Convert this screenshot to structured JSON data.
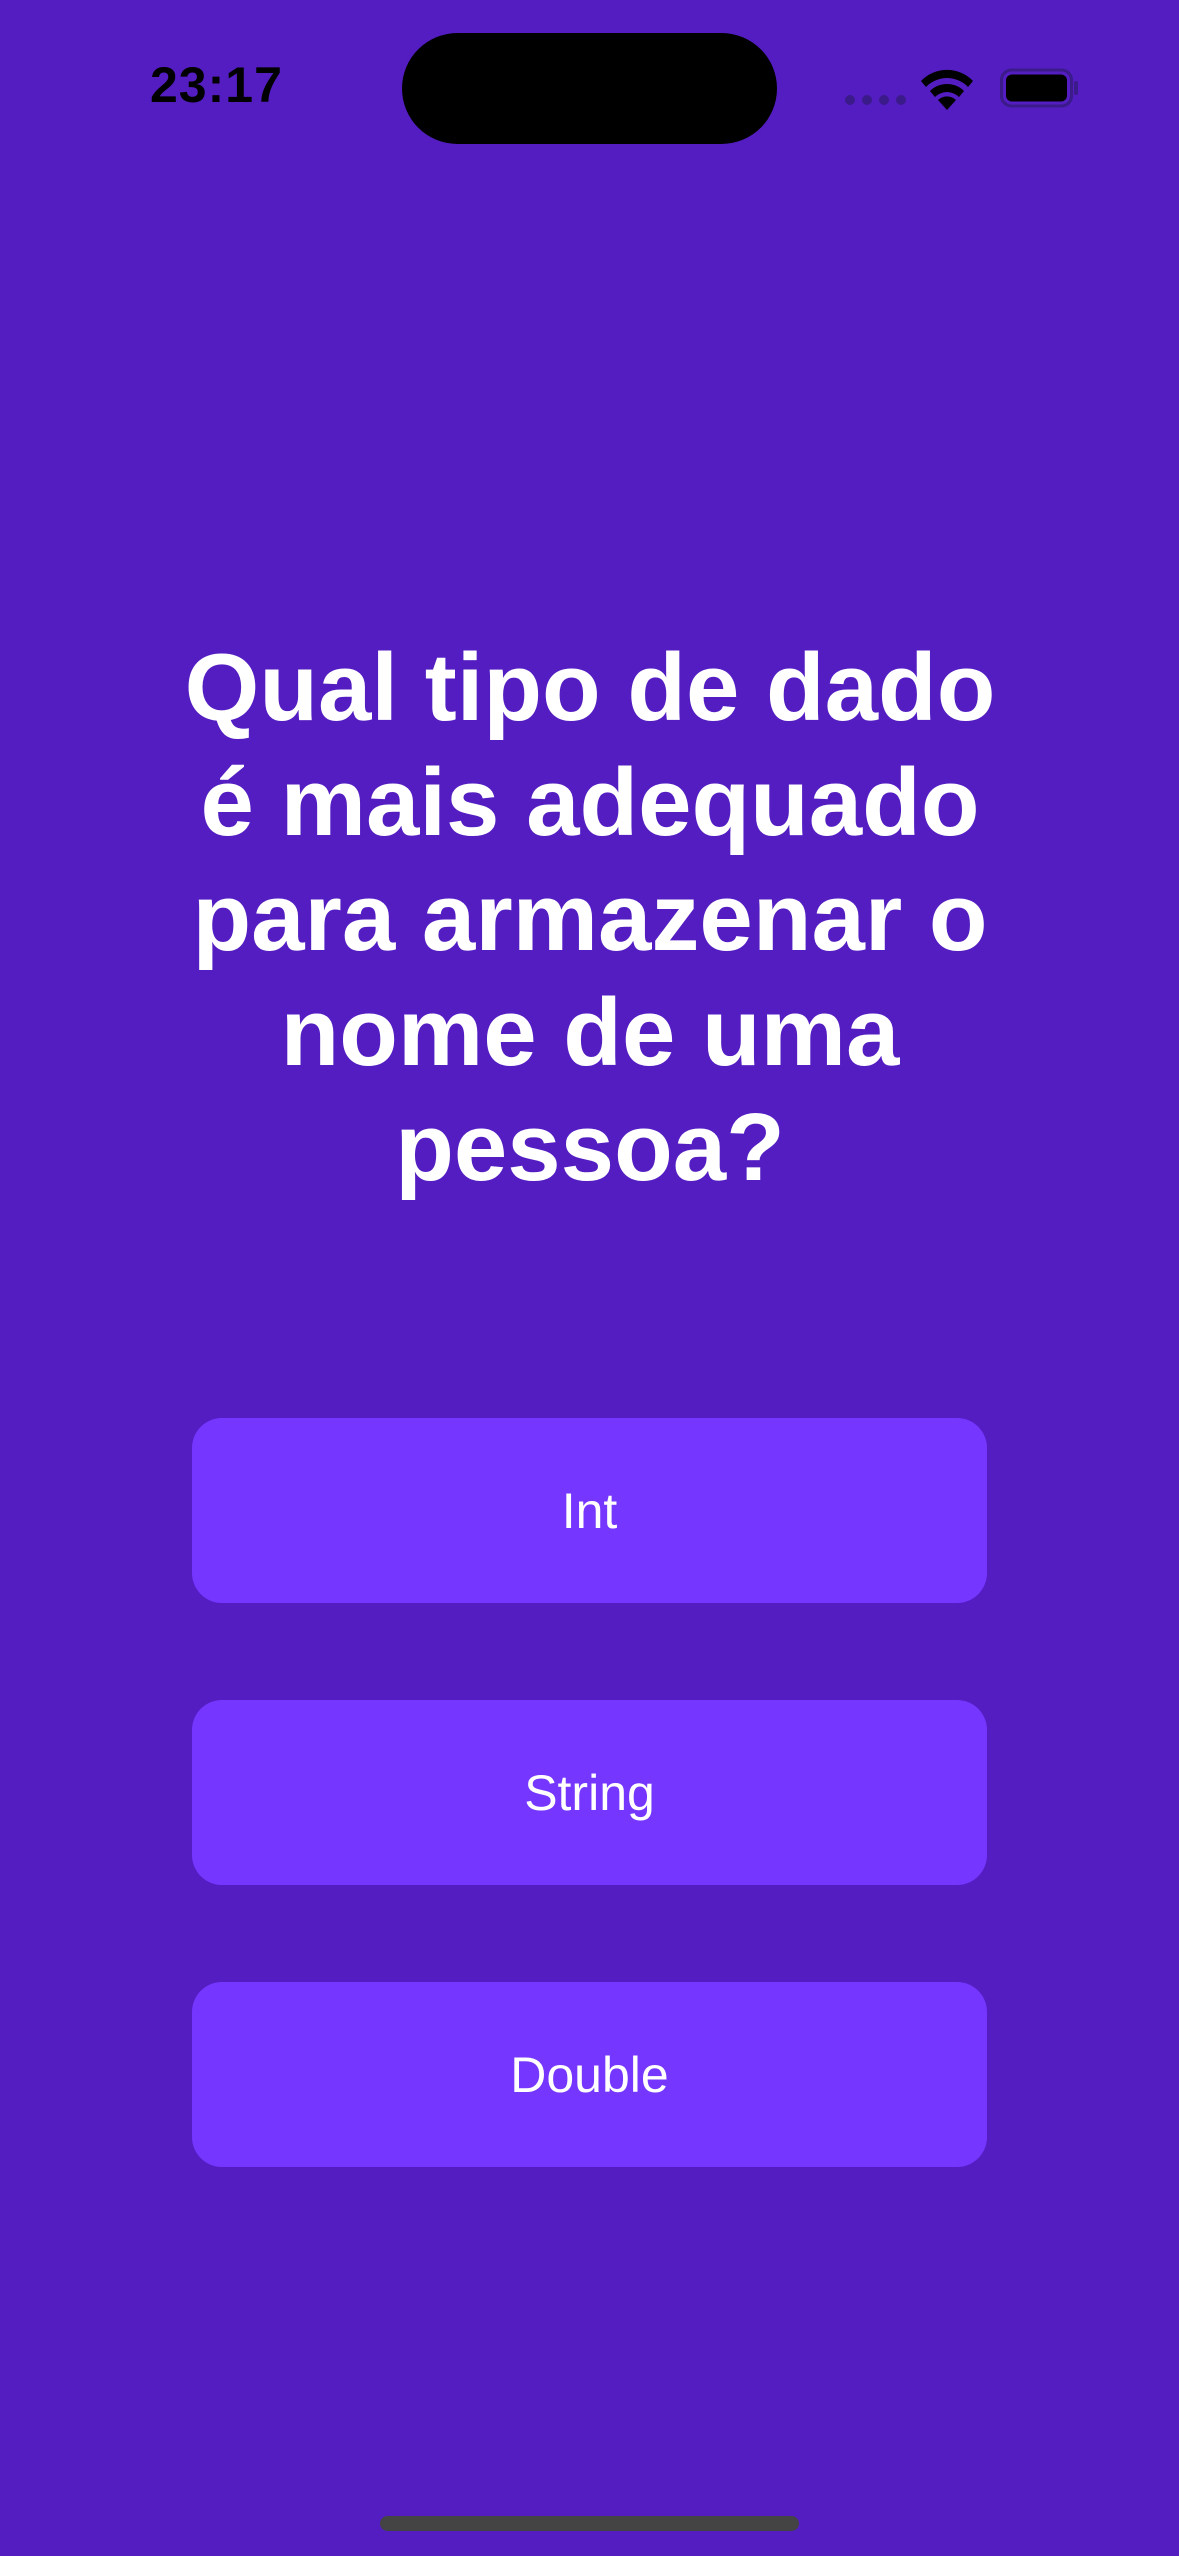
{
  "status_bar": {
    "time": "23:17",
    "icons": [
      "cellular-signal-icon",
      "wifi-icon",
      "battery-icon"
    ]
  },
  "quiz": {
    "question": "Qual tipo de dado é mais adequado para armazenar o nome de uma pessoa?",
    "answers": [
      {
        "label": "Int"
      },
      {
        "label": "String"
      },
      {
        "label": "Double"
      }
    ]
  },
  "colors": {
    "background": "#531DC2",
    "button": "#7536FF",
    "text": "#FFFFFF"
  }
}
